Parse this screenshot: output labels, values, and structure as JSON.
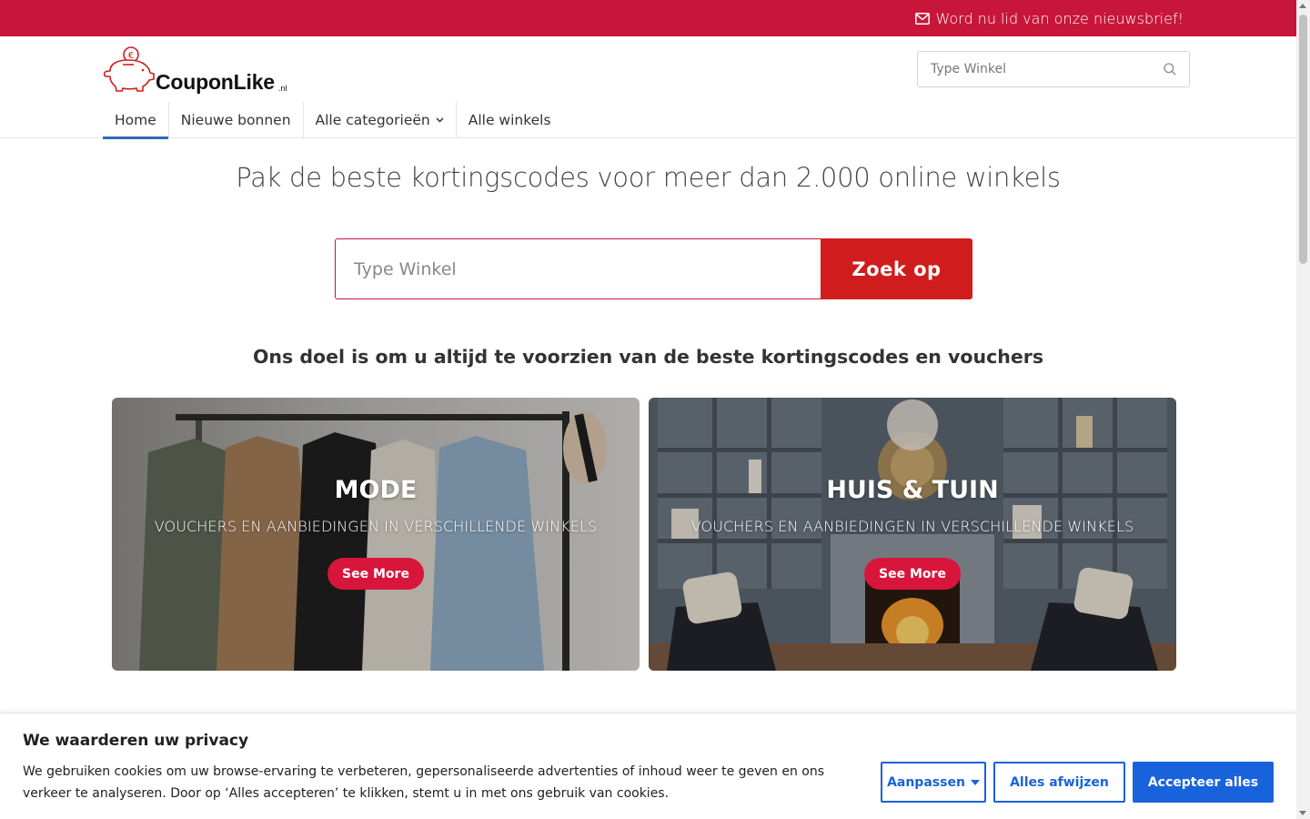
{
  "topbar": {
    "newsletter_text": "Word nu lid van onze nieuwsbrief!",
    "bg_color": "#c8163a"
  },
  "header": {
    "logo_text": "CouponLike",
    "logo_tld": ".nl",
    "search_placeholder": "Type Winkel"
  },
  "nav": {
    "items": [
      {
        "label": "Home",
        "active": true
      },
      {
        "label": "Nieuwe bonnen"
      },
      {
        "label": "Alle categorieën",
        "has_dropdown": true
      },
      {
        "label": "Alle winkels"
      }
    ]
  },
  "hero": {
    "title": "Pak de beste kortingscodes voor meer dan 2.000 online winkels",
    "search_placeholder": "Type Winkel",
    "search_button": "Zoek op",
    "subtitle": "Ons doel is om u altijd te voorzien van de beste kortingscodes en vouchers"
  },
  "cards": [
    {
      "title": "MODE",
      "subtitle": "VOUCHERS EN AANBIEDINGEN IN VERSCHILLENDE WINKELS",
      "button": "See More"
    },
    {
      "title": "HUIS & TUIN",
      "subtitle": "VOUCHERS EN AANBIEDINGEN IN VERSCHILLENDE WINKELS",
      "button": "See More"
    }
  ],
  "cookie": {
    "title": "We waarderen uw privacy",
    "text": "We gebruiken cookies om uw browse-ervaring te verbeteren, gepersonaliseerde advertenties of inhoud weer te geven en ons verkeer te analyseren. Door op ‘Alles accepteren’ te klikken, stemt u in met ons gebruik van cookies.",
    "customize_label": "Aanpassen",
    "reject_label": "Alles afwijzen",
    "accept_label": "Accepteer alles",
    "accent_color": "#1863dc"
  },
  "icons": {
    "newsletter": "envelope-icon",
    "header_search": "search-icon",
    "logo": "piggy-bank-icon"
  }
}
